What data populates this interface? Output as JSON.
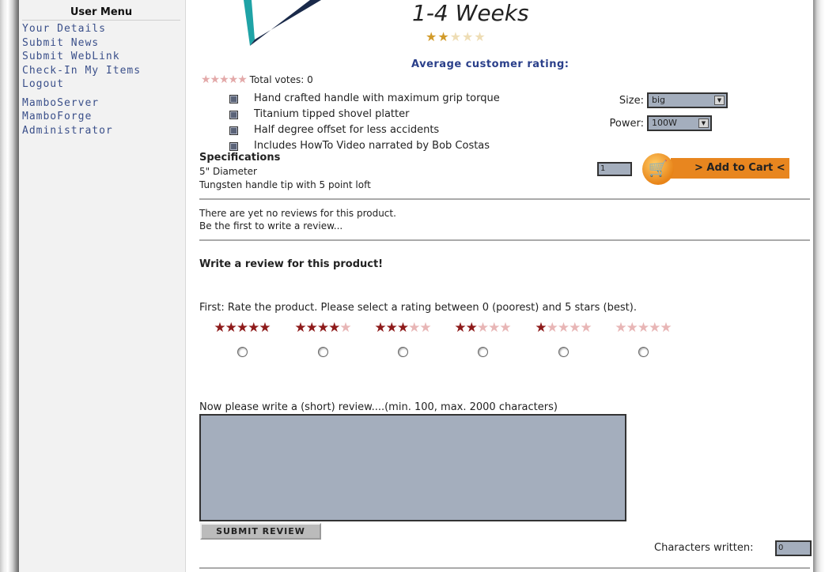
{
  "sidebar": {
    "title": "User Menu",
    "items": [
      "Your Details",
      "Submit News",
      "Submit WebLink",
      "Check-In My Items",
      "Logout"
    ],
    "links": [
      "MamboServer",
      "MamboForge",
      "Administrator"
    ]
  },
  "product": {
    "availability": "1-4 Weeks",
    "availability_stars": 2,
    "avg_rating_label": "Average customer rating:",
    "total_votes": "Total votes: 0",
    "features": [
      "Hand crafted handle with maximum grip torque",
      "Titanium tipped shovel platter",
      "Half degree offset for less accidents",
      "Includes HowTo Video narrated by Bob Costas"
    ],
    "specs_title": "Specifications",
    "specs": [
      "5\" Diameter",
      "Tungsten handle tip with 5 point loft"
    ],
    "size_label": "Size:",
    "size_value": "big",
    "power_label": "Power:",
    "power_value": "100W",
    "quantity": "1",
    "add_to_cart": "> Add to Cart <"
  },
  "reviews": {
    "none_line1": "There are yet no reviews for this product.",
    "none_line2": "Be the first to write a review...",
    "write_title": "Write a review for this product!",
    "rate_instruction": "First: Rate the product. Please select a rating between 0 (poorest) and 5 stars (best).",
    "rating_options": [
      5,
      4,
      3,
      2,
      1,
      0
    ],
    "review_instruction": "Now please write a (short) review....(min. 100, max. 2000 characters)",
    "submit_label": "SUBMIT REVIEW",
    "chars_label": "Characters written:",
    "chars_value": "0"
  },
  "colors": {
    "star_on": "#8e1b1b",
    "star_off": "#e8b6b6",
    "link": "#3a4f8a",
    "cart": "#e8861f",
    "field": "#a4aebd"
  }
}
